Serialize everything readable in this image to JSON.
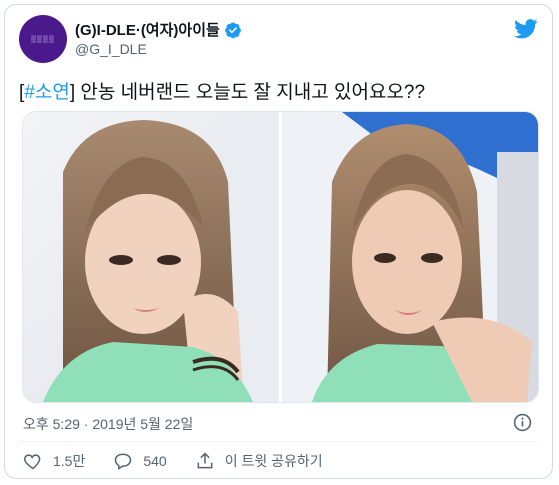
{
  "account": {
    "display_name": "(G)I-DLE·(여자)아이들",
    "handle": "@G_I_DLE",
    "avatar_icon": "purple-logo-avatar"
  },
  "tweet": {
    "hashtag": "#소연",
    "bracket_open": "[",
    "bracket_close": "]",
    "text": " 안농 네버랜드 오늘도 잘 지내고 있어요오??",
    "timestamp": "오후 5:29 · 2019년 5월 22일"
  },
  "actions": {
    "likes": "1.5만",
    "replies": "540",
    "share_label": "이 트윗 공유하기"
  },
  "colors": {
    "accent": "#1d9bf0",
    "text": "#0f1419",
    "muted": "#536471",
    "avatar": "#4a1a8c"
  }
}
